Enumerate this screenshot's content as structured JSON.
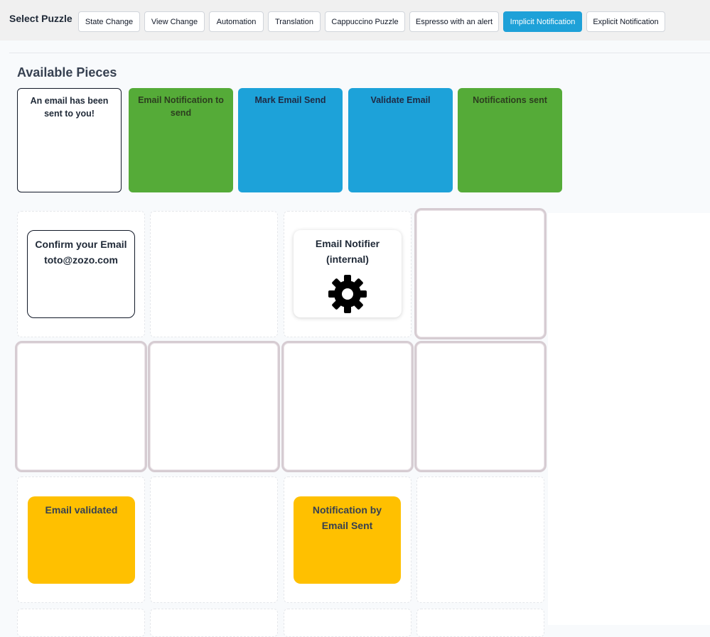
{
  "toolbar": {
    "title": "Select Puzzle",
    "buttons": [
      {
        "label": "State Change",
        "active": false
      },
      {
        "label": "View Change",
        "active": false
      },
      {
        "label": "Automation",
        "active": false
      },
      {
        "label": "Translation",
        "active": false
      },
      {
        "label": "Cappuccino Puzzle",
        "active": false
      },
      {
        "label": "Espresso with an alert",
        "active": false
      },
      {
        "label": "Implicit Notification",
        "active": true
      },
      {
        "label": "Explicit Notification",
        "active": false
      }
    ]
  },
  "available": {
    "title": "Available Pieces",
    "pieces": [
      {
        "label": "An email has been sent to you!",
        "color": "#ffffff"
      },
      {
        "label": "Email Notification to send",
        "color": "#55ab38"
      },
      {
        "label": "Mark Email Send",
        "color": "#1da2d9"
      },
      {
        "label": "Validate Email",
        "color": "#1da2d9"
      },
      {
        "label": "Notifications sent",
        "color": "#55ab38"
      }
    ]
  },
  "board": {
    "confirm_card": {
      "line1": "Confirm your Email",
      "line2": "toto@zozo.com"
    },
    "notifier_card": {
      "line1": "Email Notifier",
      "line2": "(internal)",
      "icon": "gear-icon"
    },
    "validated_card": {
      "label": "Email validated",
      "color": "#ffc000"
    },
    "notification_card": {
      "line1": "Notification by",
      "line2": "Email Sent",
      "color": "#ffc000"
    }
  },
  "colors": {
    "accent": "#1ea1d8",
    "command": "#1da2d9",
    "event": "#55ab38",
    "read_model": "#ffc000"
  }
}
